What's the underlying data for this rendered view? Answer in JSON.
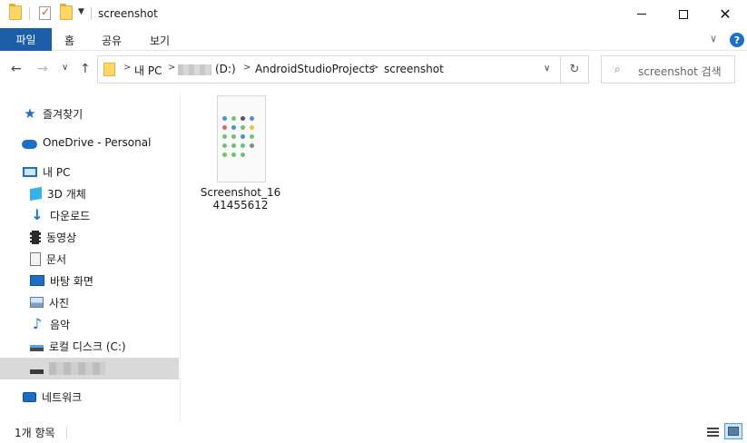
{
  "window": {
    "title": "screenshot",
    "controls": {
      "minimize": "minimize-icon",
      "maximize": "maximize-icon",
      "close": "✕"
    }
  },
  "ribbon": {
    "tabs": [
      {
        "label": "파일",
        "active": true
      },
      {
        "label": "홈"
      },
      {
        "label": "공유"
      },
      {
        "label": "보기"
      }
    ],
    "expand_glyph": "∨",
    "help_glyph": "?"
  },
  "nav": {
    "back": "←",
    "forward": "→",
    "recent": "∨",
    "up": "↑",
    "breadcrumbs": [
      "내 PC",
      "(D:)",
      "AndroidStudioProjects",
      "screenshot"
    ],
    "crumb_separator": ">",
    "dropdown": "∨",
    "refresh": "↻"
  },
  "search": {
    "placeholder": "screenshot 검색"
  },
  "sidebar": {
    "items": [
      {
        "label": "즐겨찾기",
        "icon": "star-icon"
      },
      {
        "label": "OneDrive - Personal",
        "icon": "cloud-icon"
      },
      {
        "label": "내 PC",
        "icon": "computer-icon"
      },
      {
        "label": "3D 개체",
        "icon": "cube-icon"
      },
      {
        "label": "다운로드",
        "icon": "download-icon"
      },
      {
        "label": "동영상",
        "icon": "film-icon"
      },
      {
        "label": "문서",
        "icon": "document-icon"
      },
      {
        "label": "바탕 화면",
        "icon": "desktop-icon"
      },
      {
        "label": "사진",
        "icon": "pictures-icon"
      },
      {
        "label": "음악",
        "icon": "music-icon"
      },
      {
        "label": "로컬 디스크 (C:)",
        "icon": "drive-icon"
      },
      {
        "label": "",
        "icon": "drive-icon",
        "selected": true
      },
      {
        "label": "네트워크",
        "icon": "network-icon"
      }
    ]
  },
  "files": [
    {
      "name": "Screenshot_1641455612",
      "icon": "image-thumbnail"
    }
  ],
  "status": {
    "item_count": "1개 항목"
  },
  "colors": {
    "accent": "#1c5fa8",
    "selected": "#d9d9d9",
    "folder": "#ffd766"
  }
}
